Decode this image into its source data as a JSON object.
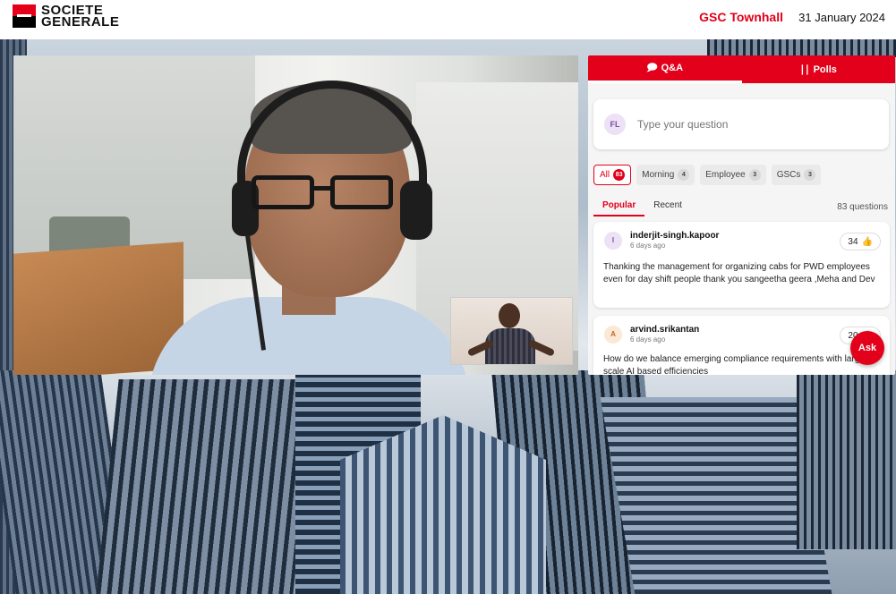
{
  "brand": {
    "line1": "SOCIETE",
    "line2": "GENERALE",
    "red": "#e2001a"
  },
  "header": {
    "event_title": "GSC Townhall",
    "date": "31 January 2024"
  },
  "panel": {
    "tabs": [
      {
        "label": "Q&A",
        "icon": "chat-bubble-icon",
        "active": true
      },
      {
        "label": "Polls",
        "icon": "bar-chart-icon",
        "active": false
      }
    ],
    "ask": {
      "avatar": "FL",
      "placeholder": "Type your question"
    },
    "filters": [
      {
        "label": "All",
        "count": "83",
        "active": true
      },
      {
        "label": "Morning",
        "count": "4",
        "active": false
      },
      {
        "label": "Employee",
        "count": "3",
        "active": false
      },
      {
        "label": "GSCs",
        "count": "3",
        "active": false
      }
    ],
    "subtabs": [
      {
        "label": "Popular",
        "active": true
      },
      {
        "label": "Recent",
        "active": false
      }
    ],
    "question_count": "83 questions",
    "questions": [
      {
        "avatar": "I",
        "name": "inderjit-singh.kapoor",
        "time": "6 days ago",
        "likes": "34",
        "text": "Thanking the management for organizing cabs for PWD employees even for day shift people thank you sangeetha geera ,Meha and Dev"
      },
      {
        "avatar": "A",
        "name": "arvind.srikantan",
        "time": "6 days ago",
        "likes": "20",
        "text": "How do we balance emerging compliance requirements with large scale AI based efficiencies"
      }
    ],
    "fab_label": "Ask"
  }
}
